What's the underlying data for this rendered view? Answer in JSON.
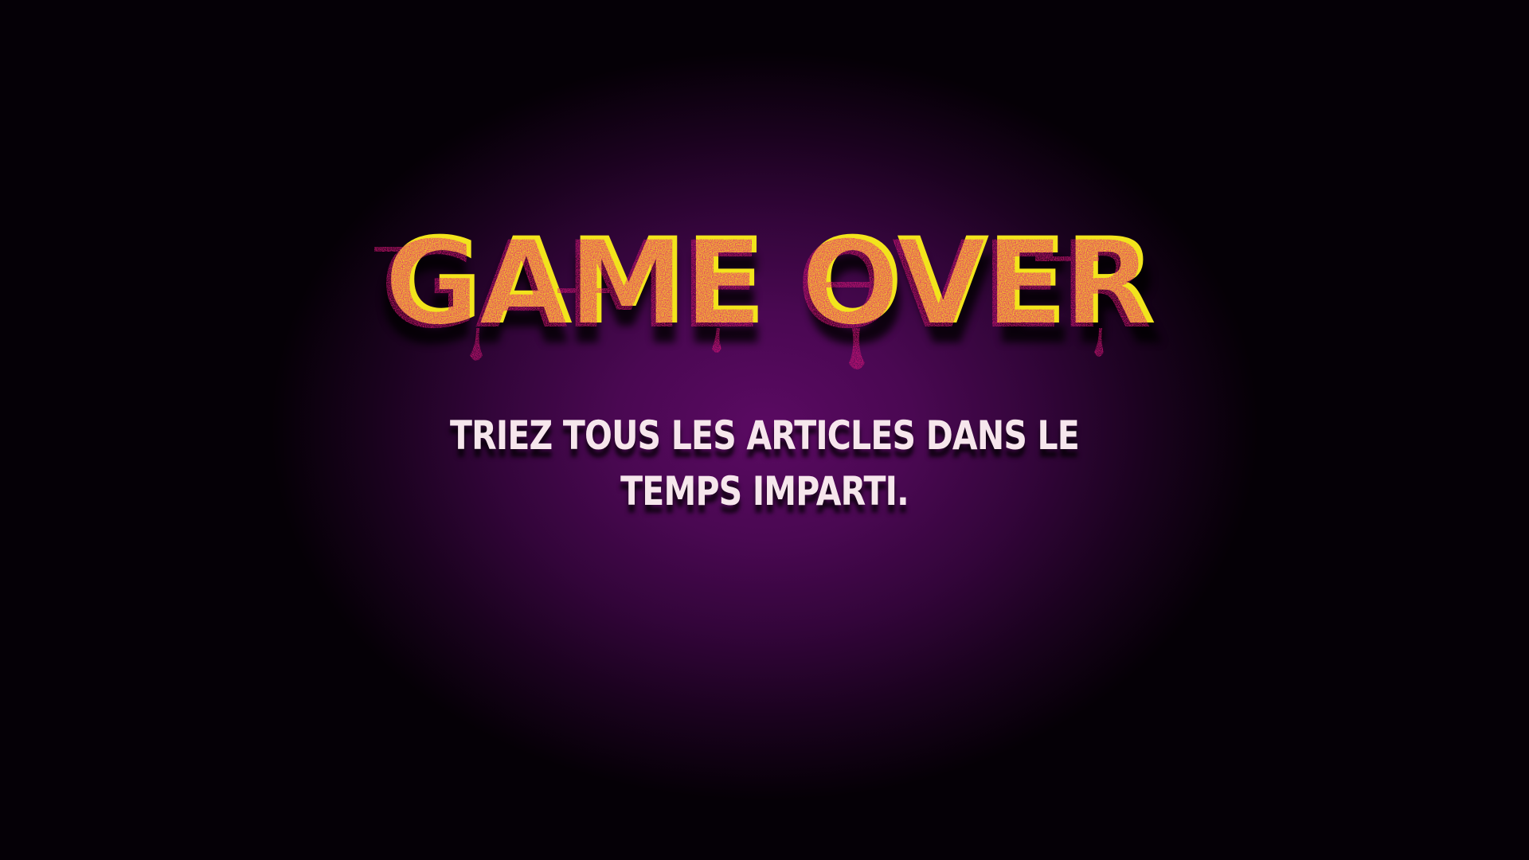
{
  "game_over": {
    "title": "GAME OVER",
    "message": "TRIEZ TOUS LES ARTICLES DANS LE TEMPS IMPARTI."
  },
  "colors": {
    "title_fill": "#e0157a",
    "title_glitch": "#f2e41c",
    "message_text": "#f6e6ec",
    "background_center": "#5a0a62",
    "background_edge": "#050006"
  }
}
